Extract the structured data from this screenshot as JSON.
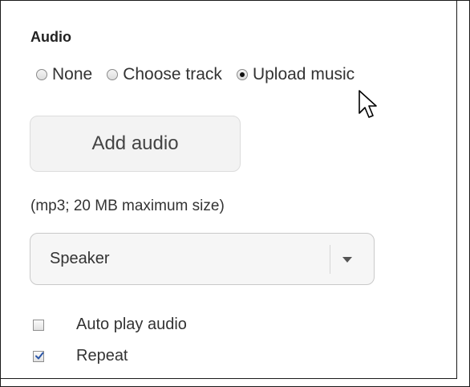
{
  "audio": {
    "heading": "Audio",
    "options": [
      {
        "label": "None",
        "selected": false
      },
      {
        "label": "Choose track",
        "selected": false
      },
      {
        "label": "Upload music",
        "selected": true
      }
    ],
    "add_button_label": "Add audio",
    "hint": "(mp3; 20 MB maximum size)",
    "select": {
      "value": "Speaker",
      "icon": "chevron-down-icon"
    },
    "checkboxes": [
      {
        "label": "Auto play audio",
        "checked": false
      },
      {
        "label": "Repeat",
        "checked": true
      }
    ],
    "colors": {
      "check": "#2a56a8",
      "button_bg": "#f3f3f3"
    }
  }
}
